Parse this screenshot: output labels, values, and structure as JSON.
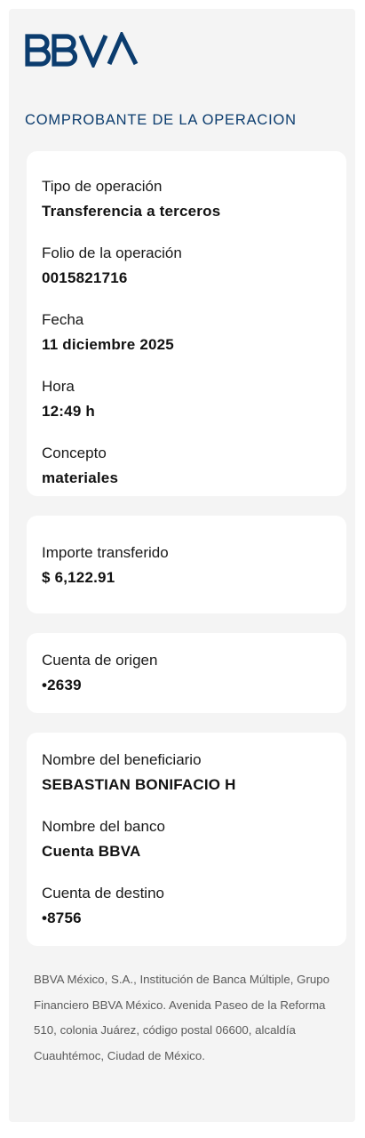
{
  "brand": {
    "logo_text": "BBVA",
    "logo_color": "#0b3c6e"
  },
  "title": "COMPROBANTE DE LA OPERACION",
  "operation": {
    "tipo_label": "Tipo de operación",
    "tipo_value": "Transferencia a terceros",
    "folio_label": "Folio de la operación",
    "folio_value": "0015821716",
    "fecha_label": "Fecha",
    "fecha_value": "11 diciembre 2025",
    "hora_label": "Hora",
    "hora_value": "12:49 h",
    "concepto_label": "Concepto",
    "concepto_value": "materiales"
  },
  "amount": {
    "label": "Importe transferido",
    "value": "$ 6,122.91"
  },
  "origin": {
    "label": "Cuenta de origen",
    "value": "•2639"
  },
  "beneficiary": {
    "name_label": "Nombre del beneficiario",
    "name_value": "SEBASTIAN BONIFACIO H",
    "bank_label": "Nombre del banco",
    "bank_value": "Cuenta BBVA",
    "dest_label": "Cuenta de destino",
    "dest_value": "•8756"
  },
  "footer": {
    "legal_text": "BBVA México, S.A., Institución de Banca Múltiple, Grupo Financiero BBVA México. Avenida Paseo de la Reforma 510, colonia Juárez, código postal 06600, alcaldía Cuauhtémoc, Ciudad de México."
  }
}
